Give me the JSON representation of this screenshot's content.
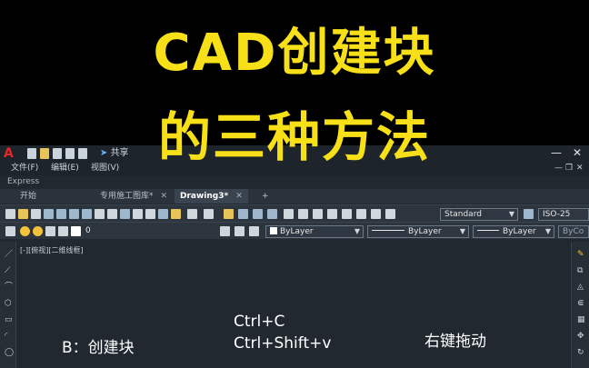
{
  "overlay": {
    "line1": "CAD创建块",
    "line2": "的三种方法"
  },
  "titlebar": {
    "logo": "A",
    "share_label": "共享",
    "minimize": "—",
    "close": "✕",
    "restore": "□"
  },
  "menu": {
    "items": [
      "文件(F)",
      "编辑(E)",
      "视图(V)"
    ],
    "express": "Express",
    "doc_min": "—",
    "doc_restore": "❐",
    "doc_close": "✕"
  },
  "tabs": [
    {
      "label": "开始"
    },
    {
      "label": "专用施工图库*",
      "close": "✕"
    },
    {
      "label": "Drawing3*",
      "close": "✕"
    },
    {
      "label": "+"
    }
  ],
  "toolbar": {
    "text_style": "Standard",
    "dim_style": "ISO-25",
    "layer": "0",
    "color": "ByLayer",
    "linetype": "ByLayer",
    "lineweight": "ByLayer",
    "plotstyle": "ByCo"
  },
  "viewport": {
    "label": "[-][俯视][二维线框]"
  },
  "canvas": {
    "method_b": "B：创建块",
    "method_copy": "Ctrl+C",
    "method_paste": "Ctrl+Shift+v",
    "method_drag": "右键拖动"
  },
  "colors": {
    "title_yellow": "#f7e017",
    "cad_bg": "#212830",
    "logo_red": "#e02828"
  }
}
